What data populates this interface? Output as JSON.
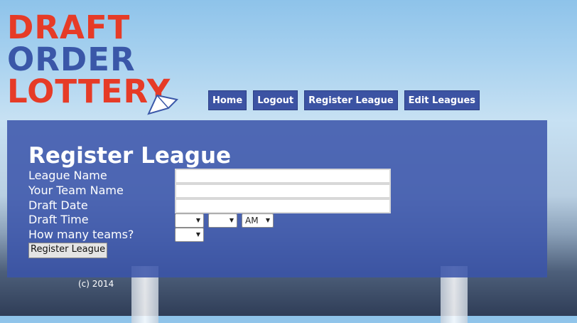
{
  "logo": {
    "line1": "DRAFT",
    "line2": "ORDER",
    "line3": "LOTTERY"
  },
  "nav": {
    "home": "Home",
    "logout": "Logout",
    "register": "Register League",
    "edit": "Edit Leagues"
  },
  "form": {
    "title": "Register League",
    "league_name_label": "League Name",
    "team_name_label": "Your Team Name",
    "draft_date_label": "Draft Date",
    "draft_time_label": "Draft Time",
    "teams_label": "How many teams?",
    "league_name_value": "",
    "team_name_value": "",
    "draft_date_value": "",
    "hour_value": "",
    "minute_value": "",
    "ampm_value": "AM",
    "teams_value": "",
    "submit_label": "Register League"
  },
  "footer": {
    "copyright": "(c) 2014"
  },
  "colors": {
    "brand_red": "#e63b27",
    "brand_blue": "#3a57a8",
    "nav_bg": "#3c53a3",
    "panel_bg": "#3a54aa"
  }
}
